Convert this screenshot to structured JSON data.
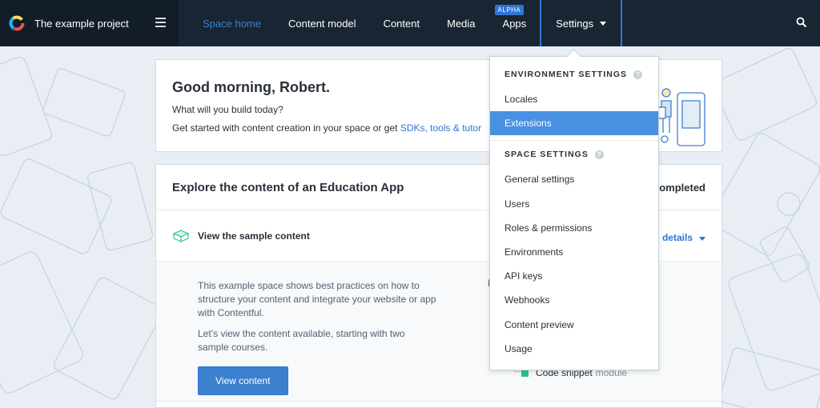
{
  "header": {
    "project_name": "The example project",
    "nav": [
      {
        "label": "Space home",
        "active": true
      },
      {
        "label": "Content model"
      },
      {
        "label": "Content"
      },
      {
        "label": "Media"
      },
      {
        "label": "Apps",
        "badge": "ALPHA"
      },
      {
        "label": "Settings"
      }
    ]
  },
  "welcome": {
    "greeting": "Good morning, Robert.",
    "question": "What will you build today?",
    "started_text": "Get started with content creation in your space or get ",
    "started_link": "SDKs, tools & tutor"
  },
  "explore": {
    "title": "Explore the content of an Education App",
    "completed": "completed",
    "sample_title": "View the sample content",
    "details_label": "e details",
    "desc_1": "This example space shows best practices on how to structure your content and integrate your website or app with Contentful.",
    "desc_2": "Let’s view the content available, starting with two sample courses.",
    "button_label": "View content",
    "h_fragment": "H",
    "code_snippet_label": "Code snippet",
    "code_snippet_suffix": "module"
  },
  "dropdown": {
    "env_header": "ENVIRONMENT SETTINGS",
    "env_items": [
      "Locales",
      "Extensions"
    ],
    "selected_item": "Extensions",
    "space_header": "SPACE SETTINGS",
    "space_items": [
      "General settings",
      "Users",
      "Roles & permissions",
      "Environments",
      "API keys",
      "Webhooks",
      "Content preview",
      "Usage"
    ],
    "help_glyph": "?"
  },
  "colors": {
    "topbar": "#192532",
    "accent": "#2e75d4",
    "selected": "#4a90e2",
    "green": "#2fc28a"
  }
}
